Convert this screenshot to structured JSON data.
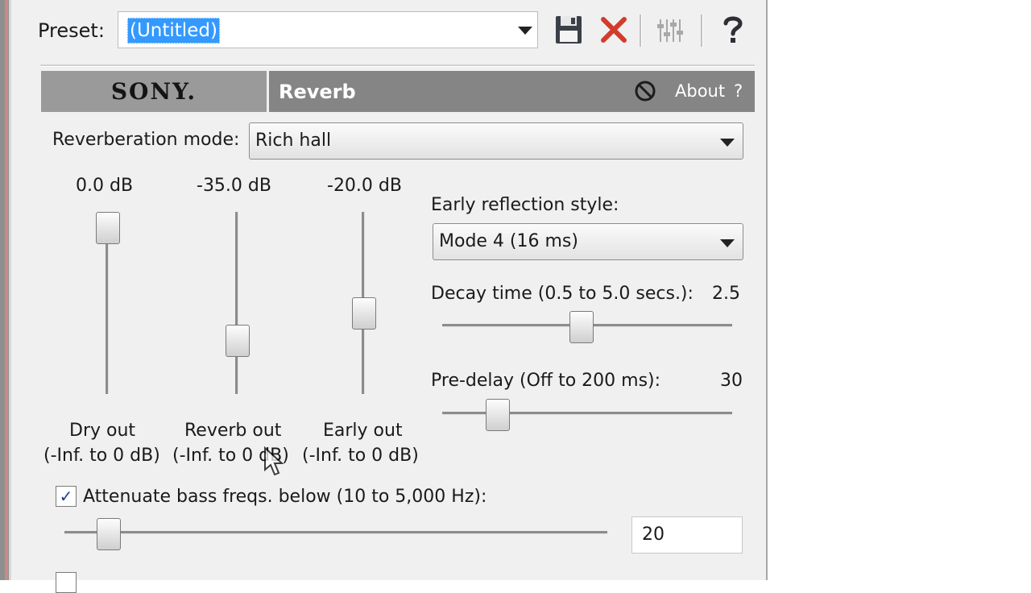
{
  "preset": {
    "label": "Preset:",
    "value": "(Untitled)"
  },
  "toolbar": {
    "save_icon": "floppy-disk-icon",
    "delete_icon": "red-x-icon",
    "channel_icon": "fader-sliders-icon",
    "help_icon": "question-mark-icon"
  },
  "banner": {
    "logo": "SONY.",
    "plugin_name": "Reverb",
    "about": "About",
    "help": "?"
  },
  "mode": {
    "label": "Reverberation mode:",
    "value": "Rich hall"
  },
  "faders": [
    {
      "value": "0.0 dB",
      "label1": "Dry out",
      "label2": "(-Inf. to 0 dB)",
      "level": 1.0
    },
    {
      "value": "-35.0 dB",
      "label1": "Reverb out",
      "label2": "(-Inf. to 0 dB)",
      "level": 0.25
    },
    {
      "value": "-20.0 dB",
      "label1": "Early out",
      "label2": "(-Inf. to 0 dB)",
      "level": 0.43
    }
  ],
  "early_reflection": {
    "label": "Early reflection style:",
    "value": "Mode 4  (16 ms)"
  },
  "decay": {
    "label": "Decay time (0.5 to 5.0 secs.):",
    "value": "2.5",
    "fraction": 0.44
  },
  "predelay": {
    "label": "Pre-delay (Off to 200 ms):",
    "value": "30",
    "fraction": 0.15
  },
  "bass": {
    "checked": true,
    "label": "Attenuate bass freqs. below (10 to 5,000 Hz):",
    "value": "20",
    "fraction": 0.06
  },
  "colors": {
    "selection": "#3399ff",
    "banner_dark": "#858585",
    "banner_logo": "#9a9a9a",
    "delete_red": "#d23c2c"
  }
}
